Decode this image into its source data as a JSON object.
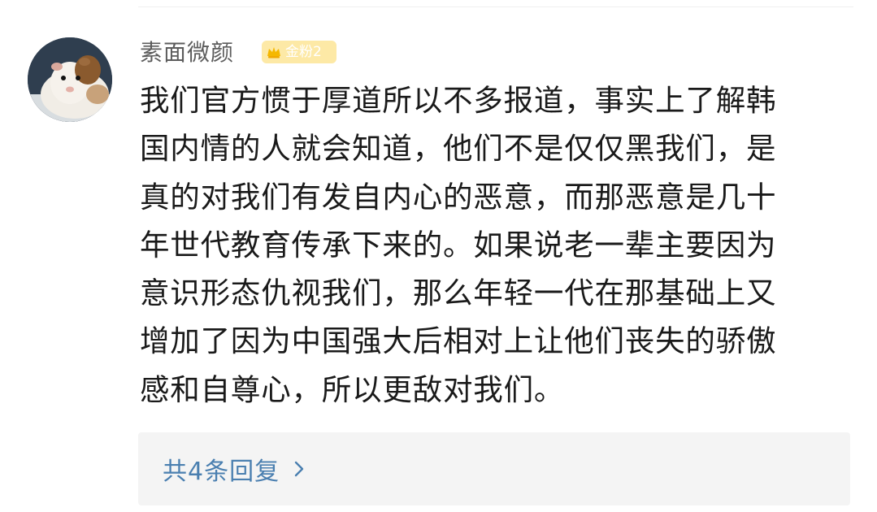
{
  "comment": {
    "username": "素面微颜",
    "fan_badge": {
      "label": "金粉2",
      "color": "#fde9a6"
    },
    "avatar_icon": "guinea-pig-avatar",
    "lines": [
      "我们官方惯于厚道所以不多报道，事实上了解韩",
      "国内情的人就会知道，他们不是仅仅黑我们，是",
      "真的对我们有发自内心的恶意，而那恶意是几十",
      "年世代教育传承下来的。如果说老一辈主要因为",
      "意识形态仇视我们，那么年轻一代在那基础上又",
      "增加了因为中国强大后相对上让他们丧失的骄傲",
      "感和自尊心，所以更敌对我们。"
    ]
  },
  "replies": {
    "label": "共4条回复",
    "icon": "chevron-right-icon",
    "link_color": "#4a7fb0"
  }
}
